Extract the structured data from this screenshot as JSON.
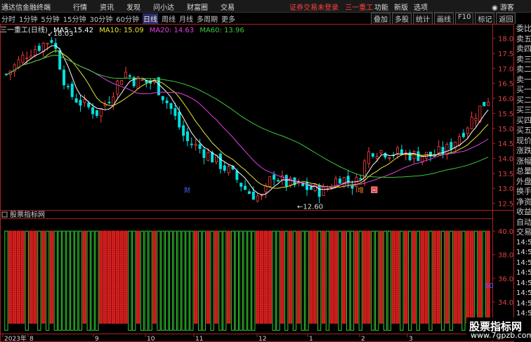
{
  "titlebar": {
    "app_name": "通达信金融终端",
    "menu": [
      "行情",
      "资讯",
      "发现",
      "问小达",
      "财富圈",
      "交易"
    ],
    "warning": "证券交易未登录",
    "stock": "三一重工",
    "right_menu": [
      "功能",
      "新版",
      "选项"
    ],
    "guest": "游客"
  },
  "toolbar": {
    "periods": [
      "分时",
      "1分钟",
      "5分钟",
      "15分钟",
      "30分钟",
      "60分钟",
      "日线",
      "周线",
      "月线",
      "多周期",
      "更多"
    ],
    "active_period": "日线",
    "tools": [
      "叠加",
      "多股",
      "统计",
      "画线",
      "F10",
      "标记",
      "返回"
    ]
  },
  "info": {
    "stock_label": "三一重工(日线)",
    "ma5_label": "MA5: 15.42",
    "ma10_label": "MA10: 15.09",
    "ma20_label": "MA20: 14.63",
    "ma60_label": "MA60: 13.96"
  },
  "colors": {
    "up": "#ff3c3c",
    "down": "#00e0e0",
    "ma5": "#ffffff",
    "ma10": "#e6e632",
    "ma20": "#e040e0",
    "ma60": "#3cc83c",
    "axis": "#b02020",
    "indicator_up": "#ff2020",
    "indicator_down": "#30d030"
  },
  "price_axis": [
    "18.00",
    "17.50",
    "17.00",
    "16.50",
    "16.00",
    "15.50",
    "15.00",
    "14.50",
    "14.00",
    "13.50",
    "13.00",
    "12.50"
  ],
  "price_labels": {
    "high": "18.03",
    "low": "12.60"
  },
  "event_tags": [
    "财",
    "增",
    "回"
  ],
  "indicator": {
    "name": "股票指标网",
    "axis": [
      "40.00",
      "38.00",
      "36.00",
      "34.00",
      "32.00"
    ],
    "marker": "60"
  },
  "date_axis": [
    "2023年",
    "8",
    "9",
    "10",
    "11",
    "12",
    "1",
    "2",
    "3"
  ],
  "right_panel": [
    "委比",
    "卖五",
    "卖四",
    "卖三",
    "卖二",
    "卖一",
    "买一",
    "买二",
    "买三",
    "买四",
    "买五",
    "现价",
    "涨跌",
    "涨幅",
    "总量",
    "外盘",
    "换手",
    "净资",
    "收益",
    "自动",
    "交易",
    "14:56",
    "14:56",
    "14:56",
    "14:56",
    "14:56",
    "14:56",
    "14:56",
    "14:56"
  ],
  "watermark": {
    "title": "股票指标网",
    "url": "www.7gpzb.com"
  }
}
